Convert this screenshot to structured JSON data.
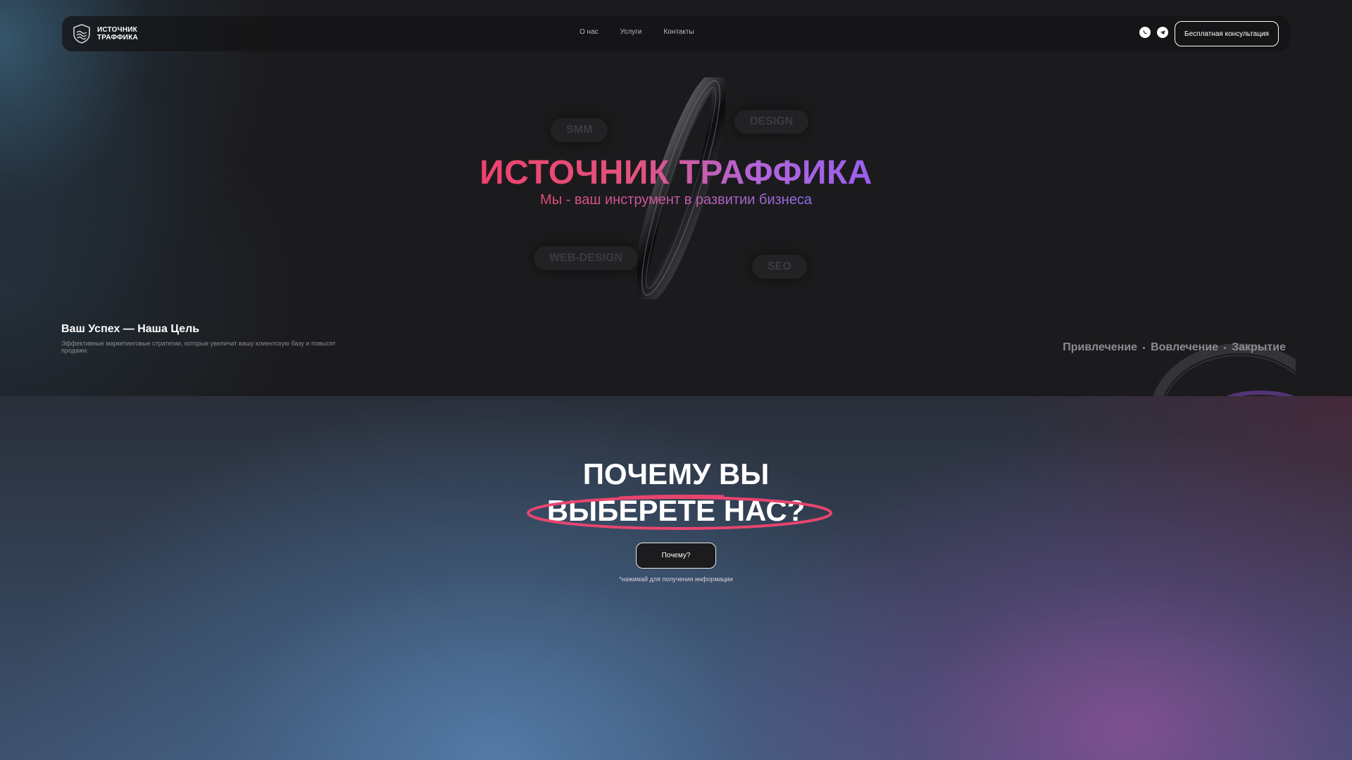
{
  "header": {
    "logo_line1": "ИСТОЧНИК",
    "logo_line2": "ТРАФФИКА",
    "nav": [
      "О нас",
      "Услуги",
      "Контакты"
    ],
    "icons": [
      "whatsapp-icon",
      "telegram-icon"
    ],
    "cta_label": "Бесплатная консультация"
  },
  "hero": {
    "title": "ИСТОЧНИК ТРАФФИКА",
    "subtitle": "Мы - ваш инструмент в развитии бизнеса",
    "tags": [
      "SMM",
      "DESIGN",
      "WEB-DESIGN",
      "SEO"
    ],
    "slogan": "Ваш Успех — Наша Цель",
    "slogan_text": "Эффективные маркетинговые стратегии, которые увеличат вашу клиентскую базу и повысят продажи.",
    "steps": [
      "Привлечение",
      "Вовлечение",
      "Закрытие"
    ]
  },
  "why": {
    "title_line1": "ПОЧЕМУ ВЫ",
    "title_line2": "ВЫБЕРЕТЕ НАС?",
    "button_label": "Почему?",
    "note": "*нажимай для получения информации"
  },
  "colors": {
    "accent_pink": "#f0416e",
    "accent_purple": "#9b5ef0",
    "background_dark": "#1b1b1d"
  }
}
